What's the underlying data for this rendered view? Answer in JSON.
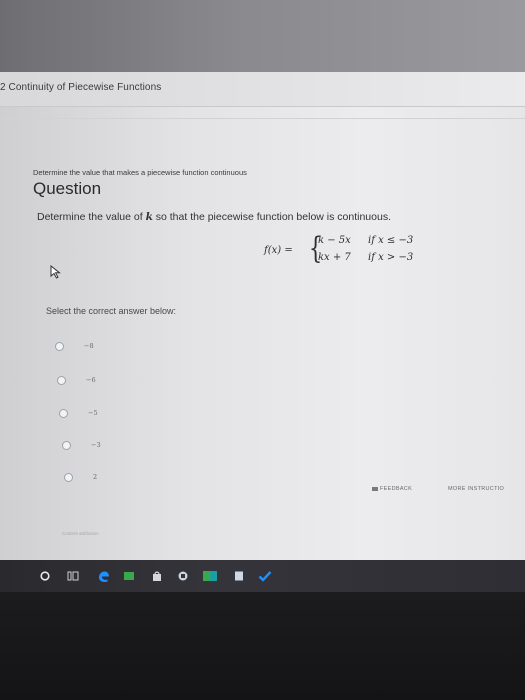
{
  "header": {
    "assignment_title": "2 Continuity of Piecewise Functions"
  },
  "question": {
    "instruction": "Determine the value that makes a piecewise function continuous",
    "heading": "Question",
    "prompt_before": "Determine the value of ",
    "prompt_variable": "k",
    "prompt_after": " so that the piecewise function below is continuous.",
    "formula": {
      "lhs": "f(x) =",
      "case1_expr": "k − 5x",
      "case1_cond": "if   x ≤ −3",
      "case2_expr": "kx + 7",
      "case2_cond": "if   x > −3"
    }
  },
  "answers": {
    "select_label": "Select the correct answer below:",
    "options": [
      {
        "label": "−8"
      },
      {
        "label": "−6"
      },
      {
        "label": "−5"
      },
      {
        "label": "−3"
      },
      {
        "label": "2"
      }
    ]
  },
  "footer": {
    "feedback_label": "FEEDBACK",
    "more_instruction_label": "MORE INSTRUCTIO",
    "content_attribution": "Content attribution"
  },
  "colors": {
    "taskbar_edge": "#1e90ff",
    "taskbar_green": "#3aa84a",
    "taskbar_teal": "#1aa0a0"
  }
}
